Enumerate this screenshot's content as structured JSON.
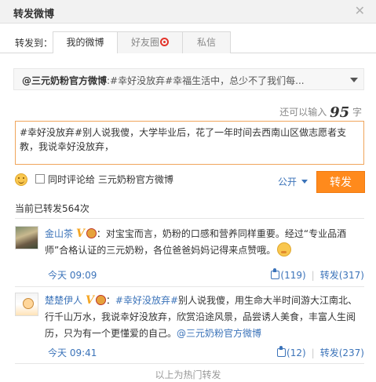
{
  "dialog": {
    "title": "转发微博",
    "close_glyph": "✕"
  },
  "tabs": {
    "label": "转发到：",
    "items": [
      {
        "label": "我的微博"
      },
      {
        "label": "好友圈"
      },
      {
        "label": "私信"
      }
    ]
  },
  "quote": {
    "author": "@三元奶粉官方微博",
    "text": ":#幸好没放弃#幸福生活中，总少不了我们每..."
  },
  "counter": {
    "prefix": "还可以输入",
    "number": "95",
    "suffix": "字"
  },
  "compose": {
    "text": "#幸好没放弃#别人说我傻，大学毕业后，花了一年时间去西南山区做志愿者支教，我说幸好没放弃，"
  },
  "options": {
    "comment_label": "同时评论给 三元奶粉官方微博",
    "visibility": "公开",
    "submit_label": "转发"
  },
  "forward_count": "当前已转发564次",
  "comments": [
    {
      "name": "金山茶",
      "text": "：对宝宝而言，奶粉的口感和营养同样重要。经过“专业品酒师”合格认证的三元奶粉，各位爸爸妈妈记得来点赞哦。",
      "time": "今天 09:09",
      "likes": "(119)",
      "forward": "转发(317)"
    },
    {
      "name": "楚楚伊人",
      "topic": "#幸好没放弃#",
      "text": "别人说我傻，用生命大半时间游大江南北、行千山万水，我说幸好没放弃，欣赏沿途风景，品尝诱人美食，丰富人生阅历，只为有一个更懂爱的自己。",
      "mention": "@三元奶粉官方微博",
      "time": "今天 09:41",
      "likes": "(12)",
      "forward": "转发(237)"
    }
  ],
  "verified_badge": "V",
  "footer": "以上为热门转发",
  "colors": {
    "accent": "#ff8a1c",
    "link": "#3b73b9",
    "compose_border": "#f0a55c"
  }
}
